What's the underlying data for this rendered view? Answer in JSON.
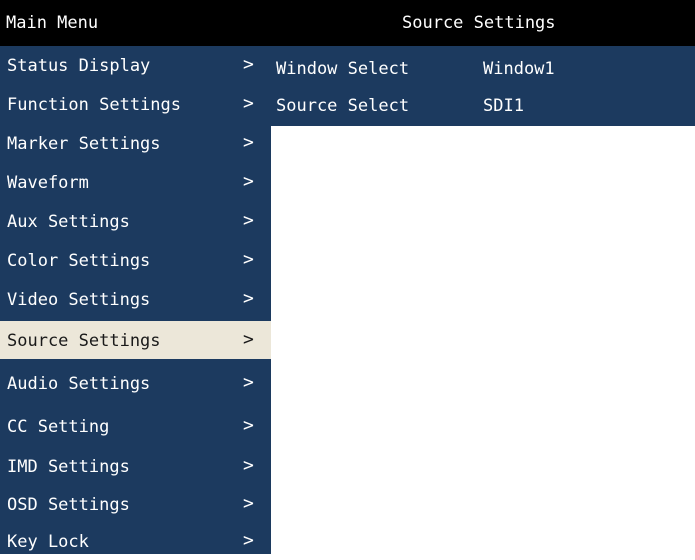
{
  "header": {
    "title": "Main Menu",
    "submenu_title": "Source Settings"
  },
  "menu": {
    "items": [
      {
        "label": "Status Display"
      },
      {
        "label": "Function Settings"
      },
      {
        "label": "Marker Settings"
      },
      {
        "label": "Waveform"
      },
      {
        "label": "Aux Settings"
      },
      {
        "label": "Color Settings"
      },
      {
        "label": "Video Settings"
      },
      {
        "label": "Source Settings",
        "selected": true
      },
      {
        "label": "Audio Settings"
      },
      {
        "label": "CC Setting"
      },
      {
        "label": "IMD Settings"
      },
      {
        "label": "OSD Settings"
      },
      {
        "label": "Key Lock"
      }
    ],
    "chevron": ">",
    "chevron_icon": "chevron-right-icon"
  },
  "detail": {
    "rows": [
      {
        "label": "Window Select",
        "value": "Window1"
      },
      {
        "label": "Source Select",
        "value": "SDI1"
      }
    ]
  },
  "colors": {
    "menu_background": "#1c3a5f",
    "header_background": "#000000",
    "selected_background": "#ece7d9",
    "text": "#ffffff",
    "selected_text": "#1a1a1a"
  }
}
